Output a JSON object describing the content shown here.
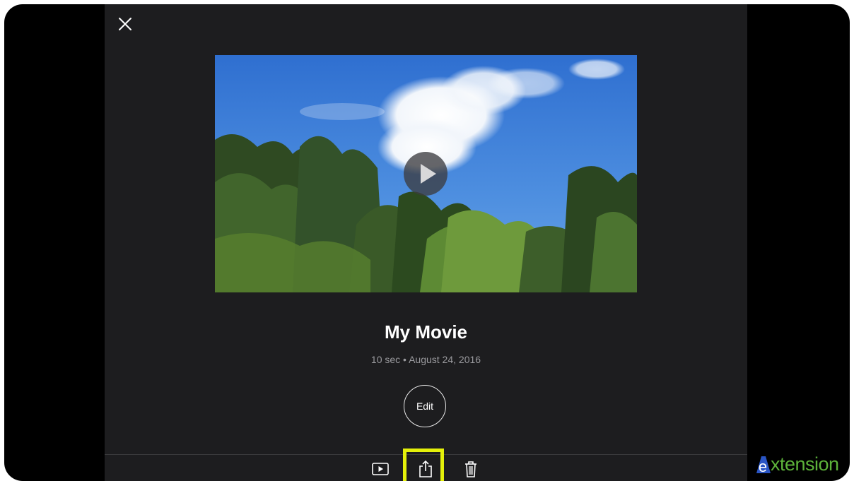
{
  "movie": {
    "title": "My Movie",
    "meta": "10 sec • August 24, 2016"
  },
  "actions": {
    "edit_label": "Edit"
  },
  "toolbar": {
    "items": [
      "play-icon",
      "share-icon",
      "trash-icon"
    ],
    "highlighted_item": "share-icon",
    "highlight_color": "#e4f00a"
  },
  "brand": {
    "logo_letter": "e",
    "logo_text": "xtension",
    "logo_color": "#5db33a",
    "logo_accent": "#2a55c4"
  },
  "colors": {
    "background": "#1d1d1f",
    "frame": "#000000",
    "meta_text": "#9a9a9e"
  }
}
